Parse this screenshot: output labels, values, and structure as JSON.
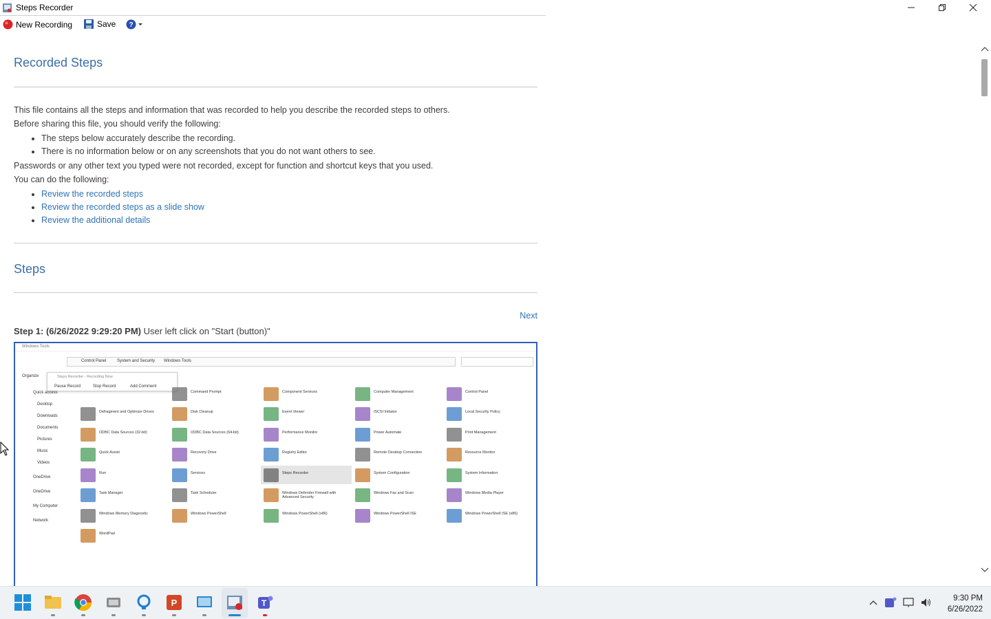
{
  "window": {
    "title": "Steps Recorder"
  },
  "toolbar": {
    "new_recording": "New Recording",
    "save": "Save",
    "help": "?"
  },
  "doc": {
    "heading": "Recorded Steps",
    "intro_1": "This file contains all the steps and information that was recorded to help you describe the recorded steps to others.",
    "intro_2": "Before sharing this file, you should verify the following:",
    "verify": [
      "The steps below accurately describe the recording.",
      "There is no information below or on any screenshots that you do not want others to see."
    ],
    "passwords": "Passwords or any other text you typed were not recorded, except for function and shortcut keys that you used.",
    "you_can": "You can do the following:",
    "links": [
      "Review the recorded steps",
      "Review the recorded steps as a slide show",
      "Review the additional details"
    ],
    "steps_heading": "Steps",
    "next": "Next",
    "step1_label": "Step 1: (6/26/2022 9:29:20 PM)",
    "step1_desc": "User left click on \"Start (button)\""
  },
  "screenshot": {
    "window_title": "Windows Tools",
    "breadcrumb": [
      "Control Panel",
      "System and Security",
      "Windows Tools"
    ],
    "organize": "Organize",
    "recorder_bar": {
      "title": "Steps Recorder - Recording Now",
      "pause": "Pause Record",
      "stop": "Stop Record",
      "comment": "Add Comment"
    },
    "nav": [
      "Quick access",
      "Desktop",
      "Downloads",
      "Documents",
      "Pictures",
      "Music",
      "Videos",
      "OneDrive",
      "OneDrive",
      "My Computer",
      "Network"
    ],
    "items": [
      [
        "",
        "Command Prompt",
        "Component Services",
        "Computer Management",
        "Control Panel"
      ],
      [
        "Defragment and Optimize Drives",
        "Disk Cleanup",
        "Event Viewer",
        "iSCSI Initiator",
        "Local Security Policy"
      ],
      [
        "ODBC Data Sources (32-bit)",
        "ODBC Data Sources (64-bit)",
        "Performance Monitor",
        "Power Automate",
        "Print Management"
      ],
      [
        "Quick Assist",
        "Recovery Drive",
        "Registry Editor",
        "Remote Desktop Connection",
        "Resource Monitor"
      ],
      [
        "Run",
        "Services",
        "Steps Recorder",
        "System Configuration",
        "System Information"
      ],
      [
        "Task Manager",
        "Task Scheduler",
        "Windows Defender Firewall with Advanced Security",
        "Windows Fax and Scan",
        "Windows Media Player"
      ],
      [
        "Windows Memory Diagnostic",
        "Windows PowerShell",
        "Windows PowerShell (x86)",
        "Windows PowerShell ISE",
        "Windows PowerShell ISE (x86)"
      ],
      [
        "WordPad",
        "",
        "",
        "",
        ""
      ]
    ]
  },
  "taskbar": {
    "time": "9:30 PM",
    "date": "6/26/2022"
  },
  "colors": {
    "heading": "#3a6ea5",
    "link": "#2e73b6",
    "shot_border": "#2e5fb7",
    "record_red": "#d9262a"
  }
}
